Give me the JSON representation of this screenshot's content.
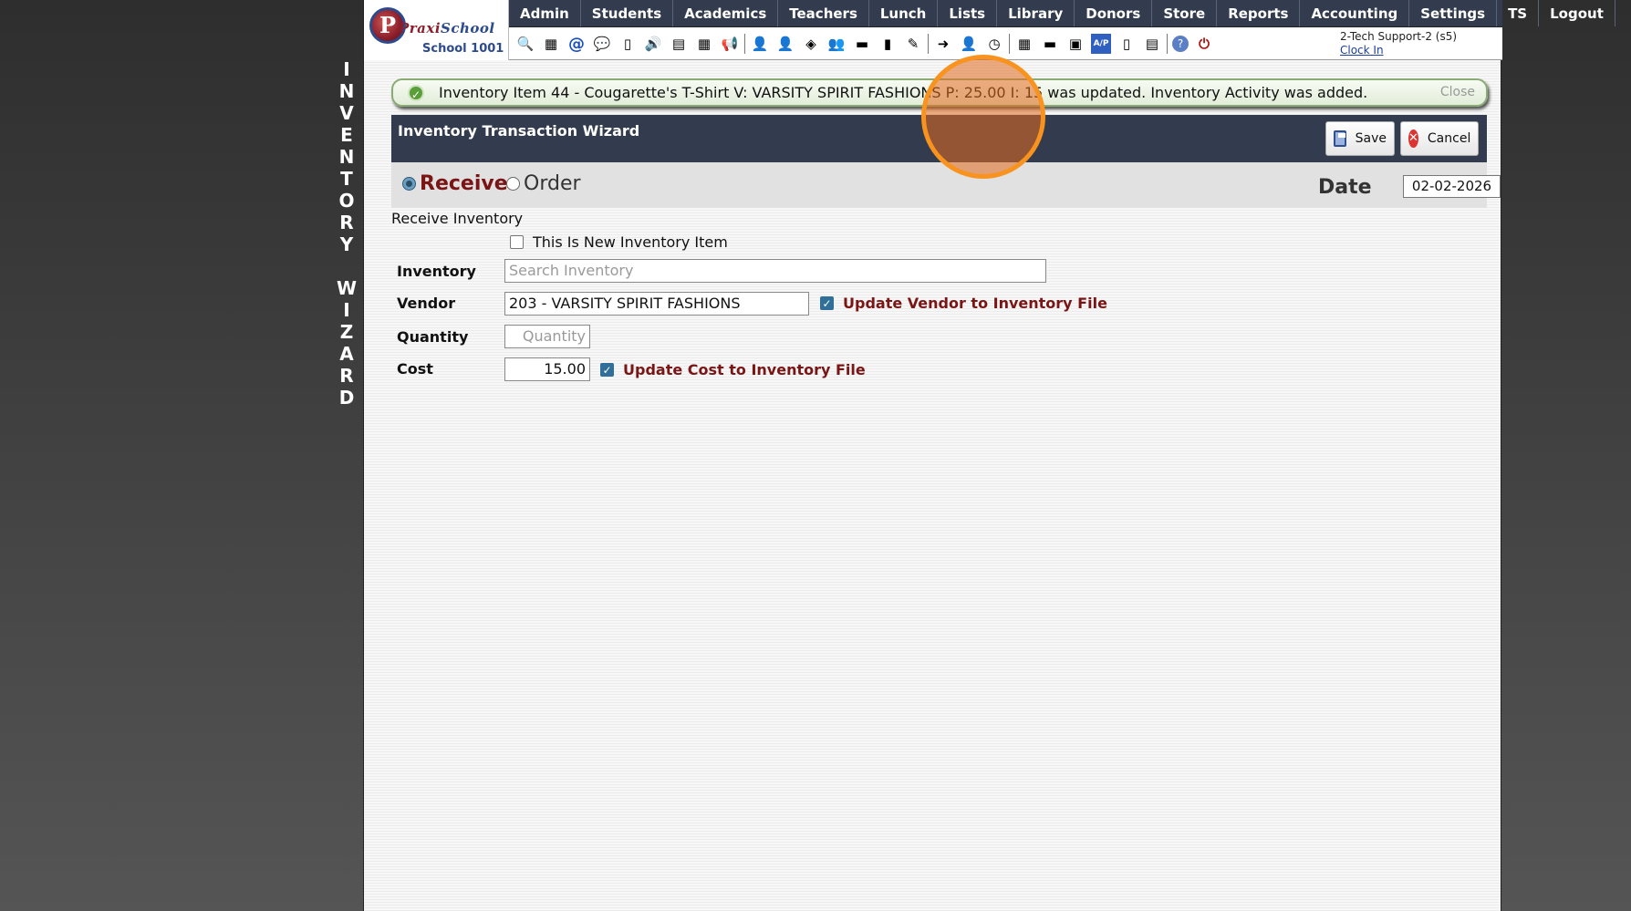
{
  "side_label": {
    "word1": [
      "I",
      "N",
      "V",
      "E",
      "N",
      "T",
      "O",
      "R",
      "Y"
    ],
    "word2": [
      "W",
      "I",
      "Z",
      "A",
      "R",
      "D"
    ]
  },
  "logo": {
    "brand_part1": "Praxi",
    "brand_part2": "School",
    "school_name": "School 1001"
  },
  "nav": {
    "items": [
      "Admin",
      "Students",
      "Academics",
      "Teachers",
      "Lunch",
      "Lists",
      "Library",
      "Donors",
      "Store",
      "Reports",
      "Accounting",
      "Settings",
      "TS",
      "Logout"
    ]
  },
  "toolbar": {
    "icons": [
      {
        "name": "search-icon",
        "glyph": "🔍"
      },
      {
        "name": "grid-icon",
        "glyph": "▦"
      },
      {
        "name": "email-icon",
        "glyph": "@"
      },
      {
        "name": "chat-icon",
        "glyph": "💬"
      },
      {
        "name": "mobile-icon",
        "glyph": "▯"
      },
      {
        "name": "speaker-icon",
        "glyph": "🔊"
      },
      {
        "name": "newsletter-icon",
        "glyph": "▤"
      },
      {
        "name": "calendar-icon",
        "glyph": "▦"
      },
      {
        "name": "megaphone-icon",
        "glyph": "📢"
      },
      {
        "name": "teacher-icon",
        "glyph": "👤"
      },
      {
        "name": "student-icon",
        "glyph": "👤"
      },
      {
        "name": "tag-icon",
        "glyph": "◈"
      },
      {
        "name": "group-icon",
        "glyph": "👥"
      },
      {
        "name": "lunch-icon",
        "glyph": "▬"
      },
      {
        "name": "book-icon",
        "glyph": "▮"
      },
      {
        "name": "donor-icon",
        "glyph": "✎"
      },
      {
        "name": "export-icon",
        "glyph": "➜"
      },
      {
        "name": "staff-icon",
        "glyph": "👤"
      },
      {
        "name": "clock-icon",
        "glyph": "◷"
      },
      {
        "name": "table-icon",
        "glyph": "▦"
      },
      {
        "name": "card-icon",
        "glyph": "▬"
      },
      {
        "name": "register-icon",
        "glyph": "▣"
      },
      {
        "name": "ap-icon",
        "glyph": "A/P"
      },
      {
        "name": "pdf-icon",
        "glyph": "▯"
      },
      {
        "name": "printer-icon",
        "glyph": "▤"
      },
      {
        "name": "help-icon",
        "glyph": "?"
      },
      {
        "name": "power-icon",
        "glyph": "⏻"
      }
    ]
  },
  "user": {
    "name": "2-Tech Support-2 (s5)",
    "clock_in": "Clock In"
  },
  "message": {
    "text": "Inventory Item 44 - Cougarette's T-Shirt V: VARSITY SPIRIT FASHIONS P: 25.00 I: 15 was updated. Inventory Activity was added.",
    "close": "Close",
    "color": "#5a9e3a"
  },
  "wizard": {
    "title": "Inventory Transaction Wizard",
    "save_label": "Save",
    "cancel_label": "Cancel",
    "mode_receive": "Receive",
    "mode_order": "Order",
    "selected_mode": "Receive",
    "date_label": "Date",
    "date_value": "02-02-2026"
  },
  "form": {
    "section_title": "Receive Inventory",
    "new_item_label": "This Is New Inventory Item",
    "new_item_checked": false,
    "inventory_label": "Inventory",
    "inventory_placeholder": "Search Inventory",
    "vendor_label": "Vendor",
    "vendor_value": "203 - VARSITY SPIRIT FASHIONS",
    "update_vendor_label": "Update Vendor to Inventory File",
    "update_vendor_checked": true,
    "quantity_label": "Quantity",
    "quantity_placeholder": "Quantity",
    "cost_label": "Cost",
    "cost_value": "15.00",
    "update_cost_label": "Update Cost to Inventory File",
    "update_cost_checked": true
  },
  "colors": {
    "nav_bg": "#333c4e",
    "accent_red": "#7a1515",
    "highlight": "#f7931e"
  }
}
